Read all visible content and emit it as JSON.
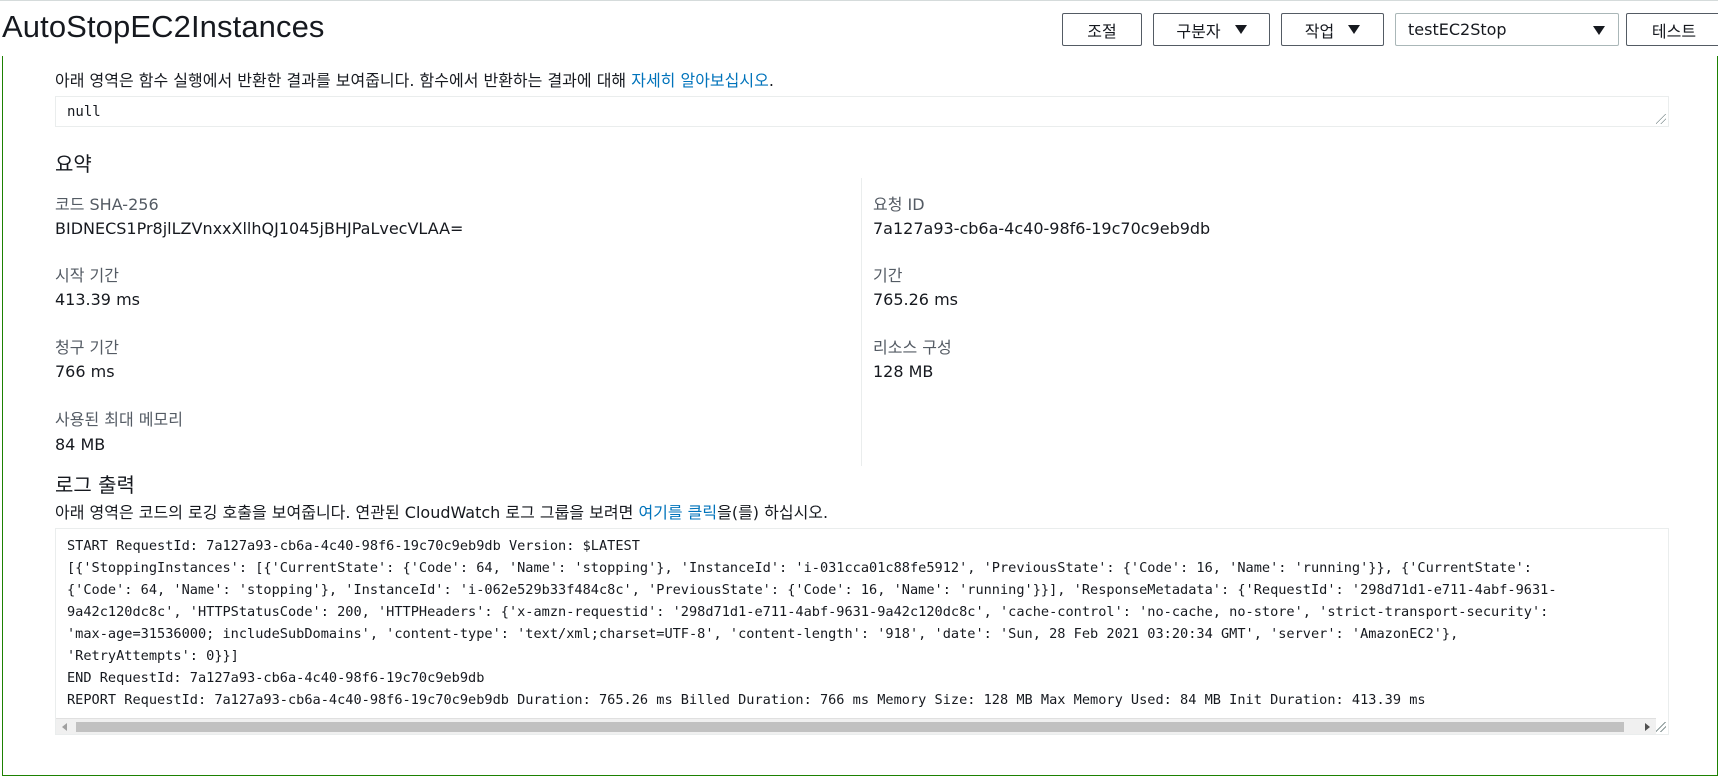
{
  "header": {
    "title": "AutoStopEC2Instances",
    "buttons": {
      "adjust": "조절",
      "qualifier": "구분자",
      "actions": "작업",
      "test": "테스트"
    },
    "test_event_select": "testEC2Stop"
  },
  "result": {
    "description": "아래 영역은 함수 실행에서 반환한 결과를 보여줍니다. 함수에서 반환하는 결과에 대해 ",
    "link": "자세히 알아보십시오",
    "suffix": ".",
    "value": "null"
  },
  "summary": {
    "title": "요약",
    "code_sha_label": "코드 SHA-256",
    "code_sha_value": "BIDNECS1Pr8jlLZVnxxXllhQJ1045jBHJPaLvecVLAA=",
    "request_id_label": "요청 ID",
    "request_id_value": "7a127a93-cb6a-4c40-98f6-19c70c9eb9db",
    "init_duration_label": "시작 기간",
    "init_duration_value": "413.39 ms",
    "duration_label": "기간",
    "duration_value": "765.26 ms",
    "billed_duration_label": "청구 기간",
    "billed_duration_value": "766 ms",
    "resources_label": "리소스 구성",
    "resources_value": "128 MB",
    "max_memory_label": "사용된 최대 메모리",
    "max_memory_value": "84 MB"
  },
  "log": {
    "title": "로그 출력",
    "description": "아래 영역은 코드의 로깅 호출을 보여줍니다. 연관된 CloudWatch 로그 그룹을 보려면 ",
    "link": "여기를 클릭",
    "suffix": "을(를) 하십시오.",
    "lines": [
      "START RequestId: 7a127a93-cb6a-4c40-98f6-19c70c9eb9db Version: $LATEST",
      "[{'StoppingInstances': [{'CurrentState': {'Code': 64, 'Name': 'stopping'}, 'InstanceId': 'i-031cca01c88fe5912', 'PreviousState': {'Code': 16, 'Name': 'running'}}, {'CurrentState':",
      "{'Code': 64, 'Name': 'stopping'}, 'InstanceId': 'i-062e529b33f484c8c', 'PreviousState': {'Code': 16, 'Name': 'running'}}], 'ResponseMetadata': {'RequestId': '298d71d1-e711-4abf-9631-",
      "9a42c120dc8c', 'HTTPStatusCode': 200, 'HTTPHeaders': {'x-amzn-requestid': '298d71d1-e711-4abf-9631-9a42c120dc8c', 'cache-control': 'no-cache, no-store', 'strict-transport-security':",
      "'max-age=31536000; includeSubDomains', 'content-type': 'text/xml;charset=UTF-8', 'content-length': '918', 'date': 'Sun, 28 Feb 2021 03:20:34 GMT', 'server': 'AmazonEC2'},",
      "'RetryAttempts': 0}}]",
      "END RequestId: 7a127a93-cb6a-4c40-98f6-19c70c9eb9db",
      "REPORT RequestId: 7a127a93-cb6a-4c40-98f6-19c70c9eb9db  Duration: 765.26 ms     Billed Duration: 766 ms Memory Size: 128 MB     Max Memory Used: 84 MB  Init Duration: 413.39 ms"
    ]
  },
  "colors": {
    "link": "#0073bb",
    "panel_border": "#1d8102",
    "label": "#545b64"
  }
}
